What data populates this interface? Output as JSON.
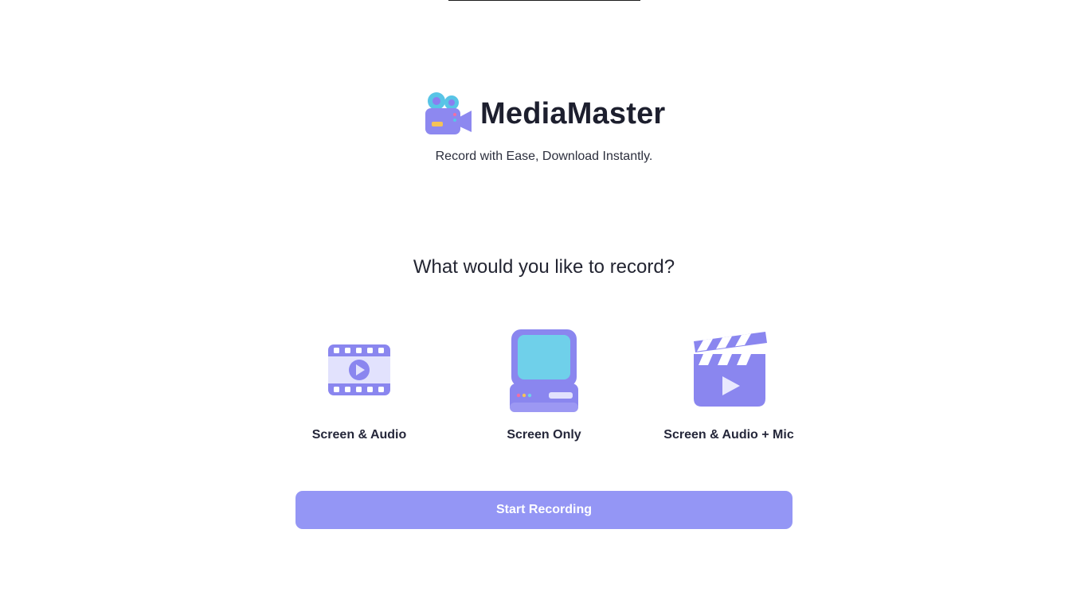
{
  "app": {
    "name": "MediaMaster",
    "tagline": "Record with Ease, Download Instantly.",
    "logo_icon": "video-camera-icon"
  },
  "prompt": {
    "question": "What would you like to record?"
  },
  "options": [
    {
      "label": "Screen & Audio",
      "icon": "film-strip-icon"
    },
    {
      "label": "Screen Only",
      "icon": "computer-monitor-icon"
    },
    {
      "label": "Screen & Audio + Mic",
      "icon": "clapperboard-icon"
    }
  ],
  "actions": {
    "start_label": "Start Recording"
  },
  "colors": {
    "accent": "#9496f5",
    "icon_purple": "#8b86ef",
    "icon_light": "#dcdcfc",
    "screen_cyan": "#6cd0ea",
    "text": "#1d1f2e"
  }
}
